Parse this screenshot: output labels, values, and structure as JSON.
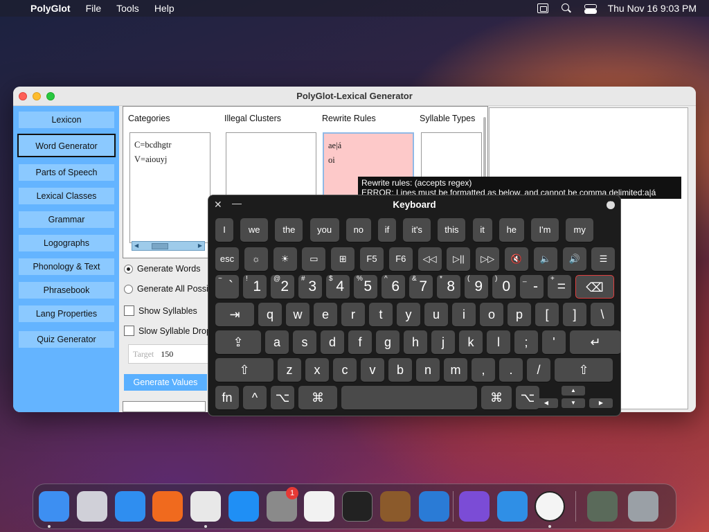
{
  "menubar": {
    "app_name": "PolyGlot",
    "menus": [
      "File",
      "Tools",
      "Help"
    ],
    "clock": "Thu Nov 16  9:03 PM"
  },
  "window": {
    "title": "PolyGlot-Lexical Generator"
  },
  "sidebar": {
    "items": [
      {
        "label": "Lexicon"
      },
      {
        "label": "Word Generator",
        "active": true
      },
      {
        "label": "Parts of Speech"
      },
      {
        "label": "Lexical Classes"
      },
      {
        "label": "Grammar"
      },
      {
        "label": "Logographs"
      },
      {
        "label": "Phonology & Text"
      },
      {
        "label": "Phrasebook"
      },
      {
        "label": "Lang Properties"
      },
      {
        "label": "Quiz Generator"
      }
    ]
  },
  "columns": {
    "categories_label": "Categories",
    "illegal_label": "Illegal Clusters",
    "rewrite_label": "Rewrite Rules",
    "syllable_label": "Syllable Types",
    "categories_lines": [
      "C=bcdhgtr",
      "V=aiouyj"
    ],
    "rewrite_lines": [
      "ae|á",
      "oi"
    ]
  },
  "options": {
    "generate_words": "Generate Words",
    "generate_all": "Generate All Possi",
    "show_syllables": "Show Syllables",
    "slow_drop": "Slow Syllable Drop",
    "target_placeholder": "Target",
    "target_value": "150",
    "generate_values": "Generate Values"
  },
  "tooltip": {
    "line1": "Rewrite rules: (accepts regex)",
    "line2": "ERROR: Lines must be formatted as below, and cannot be comma delimited:a|á"
  },
  "keyboard": {
    "title": "Keyboard",
    "suggestions": [
      "I",
      "we",
      "the",
      "you",
      "no",
      "if",
      "it's",
      "this",
      "it",
      "he",
      "I'm",
      "my"
    ],
    "fn_row": [
      "esc",
      "☼",
      "☀",
      "▭",
      "⊞",
      "F5",
      "F6",
      "◁◁",
      "▷||",
      "▷▷",
      "🔇",
      "🔈",
      "🔊",
      "☰"
    ],
    "number_row": [
      {
        "sup": "~",
        "main": "`"
      },
      {
        "sup": "!",
        "main": "1"
      },
      {
        "sup": "@",
        "main": "2"
      },
      {
        "sup": "#",
        "main": "3"
      },
      {
        "sup": "$",
        "main": "4"
      },
      {
        "sup": "%",
        "main": "5"
      },
      {
        "sup": "^",
        "main": "6"
      },
      {
        "sup": "&",
        "main": "7"
      },
      {
        "sup": "*",
        "main": "8"
      },
      {
        "sup": "(",
        "main": "9"
      },
      {
        "sup": ")",
        "main": "0"
      },
      {
        "sup": "_",
        "main": "-"
      },
      {
        "sup": "+",
        "main": "="
      },
      {
        "sup": "",
        "main": "⌫"
      }
    ],
    "qwerty_row": [
      "⇥",
      "q",
      "w",
      "e",
      "r",
      "t",
      "y",
      "u",
      "i",
      "o",
      "p",
      "[",
      "]",
      "\\"
    ],
    "home_row": [
      "⇪",
      "a",
      "s",
      "d",
      "f",
      "g",
      "h",
      "j",
      "k",
      "l",
      ";",
      "'",
      "↵"
    ],
    "bottom_row": [
      "⇧",
      "z",
      "x",
      "c",
      "v",
      "b",
      "n",
      "m",
      ",",
      ".",
      "/",
      "⇧"
    ],
    "space_row": [
      "fn",
      "^",
      "⌥",
      "⌘",
      "",
      "⌘",
      "⌥"
    ],
    "arrows": [
      "▲",
      "◀",
      "▼",
      "▶"
    ]
  },
  "dock": {
    "badge_count": "1",
    "apps": [
      "finder-icon",
      "launchpad-icon",
      "safari-icon",
      "firefox-icon",
      "chrome-icon",
      "app-store-icon",
      "system-settings-icon",
      "textedit-icon",
      "terminal-icon",
      "garageband-icon",
      "vscode-icon",
      "visual-studio-icon",
      "weather-icon",
      "polyglot-icon",
      "preview-icon",
      "trash-icon"
    ]
  }
}
